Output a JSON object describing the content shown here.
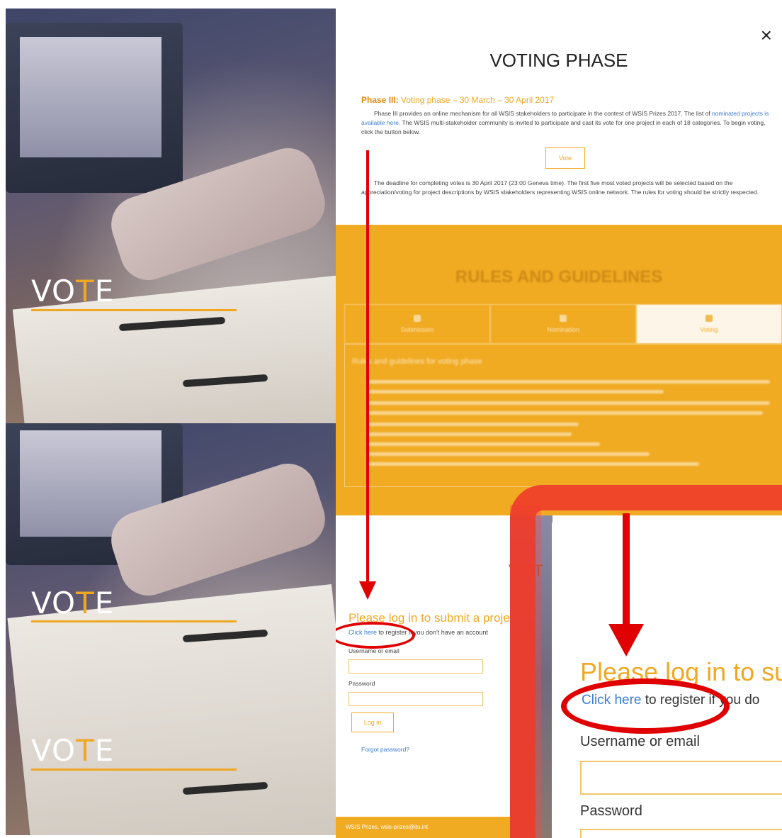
{
  "left_panel": {
    "banners": [
      {
        "word_before": "VO",
        "word_accent": "T",
        "word_after": "E"
      },
      {
        "word_before": "VO",
        "word_accent": "T",
        "word_after": "E"
      },
      {
        "word_before": "VO",
        "word_accent": "T",
        "word_after": "E"
      }
    ]
  },
  "modal": {
    "close_symbol": "×",
    "title": "VOTING PHASE",
    "phase_label": "Phase III:",
    "phase_text": " Voting phase – 30 March – 30 April 2017",
    "intro_start": "Phase III provides an online mechanism for all WSIS stakeholders to participate in the contest of WSIS Prizes 2017. The list of ",
    "intro_link": "nominated projects is available here.",
    "intro_end": " The WSIS multi-stakeholder community is invited to participate and cast its vote for one project in each of 18 categories. To begin voting, click the button below.",
    "vote_button": "Vote",
    "deadline_text": "The deadline for completing votes is 30 April 2017 (23:00 Geneva time). The first five most voted projects will be selected based on the appreciation/voting for project descriptions by WSIS stakeholders representing WSIS online network. The rules for voting should be strictly respected."
  },
  "rules": {
    "title": "RULES AND GUIDELINES",
    "tabs": [
      {
        "label": "Submission",
        "icon": "paper-plane-icon"
      },
      {
        "label": "Nomination",
        "icon": "list-icon"
      },
      {
        "label": "Voting",
        "icon": "thumbs-up-icon"
      }
    ],
    "box_title": "Rules and guidelines for voting phase"
  },
  "login": {
    "title": "Please log in to submit a project",
    "register_link": "Click here",
    "register_rest": " to register if you don't have an account",
    "username_label": "Username or email",
    "password_label": "Password",
    "login_button": "Log in",
    "forgot_link": "Forgot password?",
    "footer": "WSIS Prizes, wsis-prizes@itu.int",
    "vot_fragment": "VOT"
  },
  "zoom": {
    "title": "Please log in to su",
    "register_link": "Click here",
    "register_rest": " to register if you do",
    "username_label": "Username or email",
    "password_label": "Password"
  },
  "colors": {
    "accent": "#f0a823",
    "annotation_red": "#e00000",
    "link": "#3a7bd5"
  }
}
